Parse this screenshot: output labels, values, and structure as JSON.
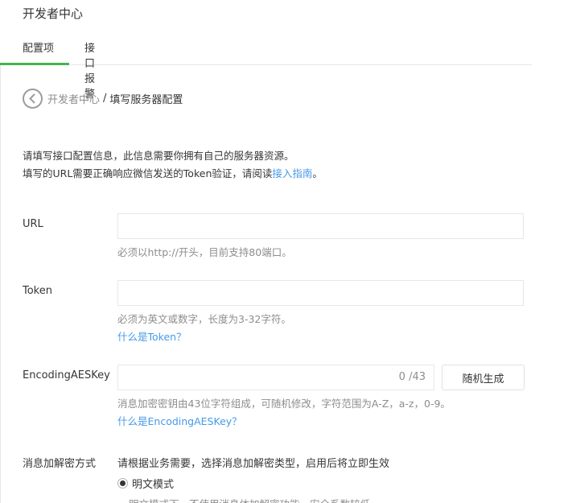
{
  "page": {
    "title": "开发者中心"
  },
  "tabs": [
    {
      "label": "配置项",
      "active": true
    },
    {
      "label": "接口报警",
      "active": false
    }
  ],
  "breadcrumb": {
    "parent": "开发者中心",
    "separator": "/",
    "current": "填写服务器配置",
    "back_icon": "chevron-left-circle"
  },
  "intro": {
    "line1": "请填写接口配置信息，此信息需要你拥有自己的服务器资源。",
    "line2_prefix": "填写的URL需要正确响应微信发送的Token验证，请阅读",
    "line2_link": "接入指南",
    "line2_suffix": "。"
  },
  "url": {
    "label": "URL",
    "value": "",
    "tip": "必须以http://开头，目前支持80端口。"
  },
  "token": {
    "label": "Token",
    "value": "",
    "tip": "必须为英文或数字，长度为3-32字符。",
    "help_link": "什么是Token？"
  },
  "aes": {
    "label": "EncodingAESKey",
    "value": "",
    "counter": "0 /43",
    "generate_label": "随机生成",
    "tip": "消息加密密钥由43位字符组成，可随机修改，字符范围为A-Z，a-z，0-9。",
    "help_link": "什么是EncodingAESKey？"
  },
  "encryption": {
    "label": "消息加解密方式",
    "description": "请根据业务需要，选择消息加解密类型，启用后将立即生效",
    "selected_option": "明文模式",
    "option_desc": "明文模式下，不使用消息体加解密功能，安全系数较低"
  },
  "colors": {
    "accent_green": "#44b549",
    "link_blue": "#459ae9",
    "muted": "#8d8d8d"
  }
}
